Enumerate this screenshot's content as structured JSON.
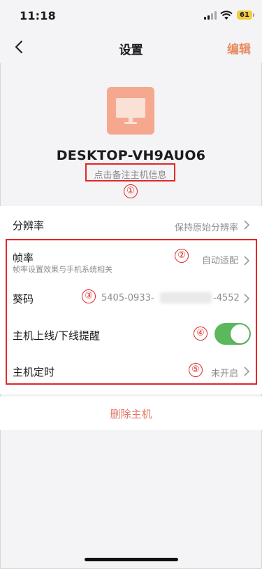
{
  "status_bar": {
    "time": "11:18",
    "battery": "61"
  },
  "nav": {
    "title": "设置",
    "edit_label": "编辑",
    "back_icon": "chevron-left-icon"
  },
  "host": {
    "icon": "monitor-icon",
    "name": "DESKTOP-VH9AUO6",
    "remark_placeholder": "点击备注主机信息"
  },
  "annotations": {
    "a1": "①",
    "a2": "②",
    "a3": "③",
    "a4": "④",
    "a5": "⑤",
    "color": "#e12828"
  },
  "settings": {
    "resolution": {
      "label": "分辨率",
      "value": "保持原始分辨率"
    },
    "framerate": {
      "label": "帧率",
      "subtitle": "帧率设置效果与手机系统相关",
      "value": "自动适配"
    },
    "code": {
      "label": "葵码",
      "value_prefix": "5405-0933-",
      "value_suffix": "-4552"
    },
    "online_alert": {
      "label": "主机上线/下线提醒",
      "enabled": true
    },
    "schedule": {
      "label": "主机定时",
      "value": "未开启"
    }
  },
  "actions": {
    "delete_label": "删除主机"
  },
  "colors": {
    "accent": "#e98a5f",
    "toggle_on": "#5cb85c",
    "delete": "#e4786c",
    "tile": "#f5a88e"
  }
}
